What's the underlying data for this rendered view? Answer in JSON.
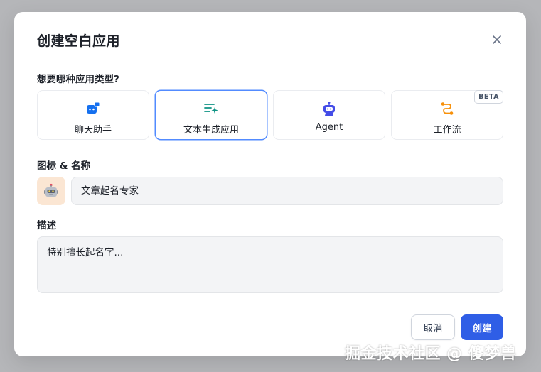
{
  "dialog": {
    "title": "创建空白应用",
    "close_icon": "close-icon"
  },
  "app_type": {
    "label": "想要哪种应用类型?",
    "options": [
      {
        "name": "聊天助手",
        "icon": "chat-bot-icon",
        "color": "#1570ef",
        "selected": false
      },
      {
        "name": "文本生成应用",
        "icon": "text-sparkle-icon",
        "color": "#0e9384",
        "selected": true
      },
      {
        "name": "Agent",
        "icon": "agent-robot-icon",
        "color": "#444ce7",
        "selected": false
      },
      {
        "name": "工作流",
        "icon": "workflow-icon",
        "color": "#f79009",
        "selected": false,
        "badge": "BETA"
      }
    ]
  },
  "icon_name": {
    "label": "图标 & 名称",
    "icon": "robot-emoji-icon",
    "icon_bg": "#fbe6d3",
    "name_value": "文章起名专家"
  },
  "description": {
    "label": "描述",
    "value": "特别擅长起名字..."
  },
  "footer": {
    "cancel_label": "取消",
    "create_label": "创建"
  },
  "watermark": "掘金技术社区 @ 傻梦兽",
  "colors": {
    "primary": "#2f5ee6",
    "selected_border": "#528bff",
    "overlay": "#b5b6b9"
  }
}
